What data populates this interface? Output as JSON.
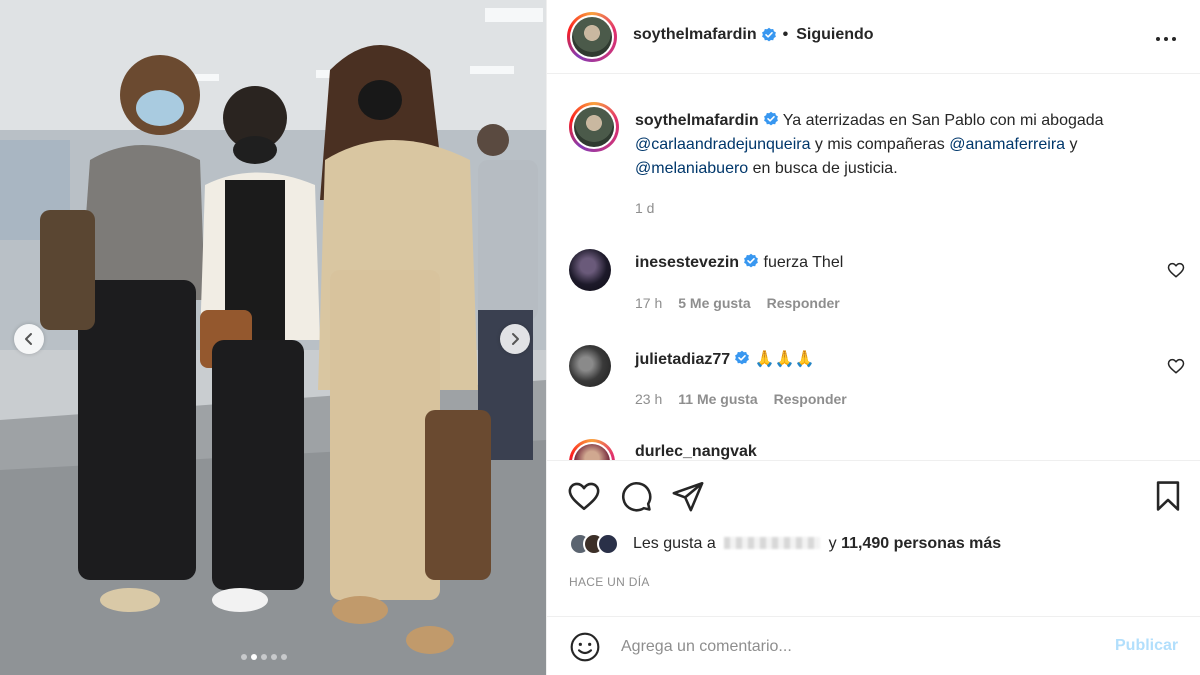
{
  "post": {
    "username": "soythelmafardin",
    "follow_status": "Siguiendo",
    "separator": "•",
    "caption": {
      "part1": "Ya aterrizadas en San Pablo con mi abogada",
      "mention1": "@carlaandradejunqueira",
      "part2": "y mis compañeras",
      "mention2": "@anamaferreira",
      "part3": "y",
      "mention3": "@melaniabuero",
      "part4": "en busca de justicia."
    },
    "caption_age": "1 d",
    "likes_prefix": "Les gusta a",
    "likes_suffix": "y",
    "likes_count": "11,490 personas más",
    "time_ago": "HACE UN DÍA",
    "comment_placeholder": "Agrega un comentario...",
    "publish_label": "Publicar"
  },
  "comments": [
    {
      "username": "inesestevezin",
      "text": "fuerza Thel",
      "age": "17 h",
      "likes": "5 Me gusta",
      "reply": "Responder"
    },
    {
      "username": "julietadiaz77",
      "text": "🙏🙏🙏",
      "age": "23 h",
      "likes": "11 Me gusta",
      "reply": "Responder"
    },
    {
      "username": "durlec_nangvak",
      "text": ""
    }
  ],
  "carousel": {
    "total": 5,
    "active": 1
  },
  "colors": {
    "mention": "#00376b",
    "verified": "#3897f0",
    "muted": "#8e8e8e",
    "publish": "#b2dffc"
  },
  "icons": [
    "chevron-left-icon",
    "chevron-right-icon",
    "more-icon",
    "verified-icon",
    "heart-icon",
    "comment-icon",
    "share-icon",
    "bookmark-icon",
    "emoji-icon"
  ]
}
